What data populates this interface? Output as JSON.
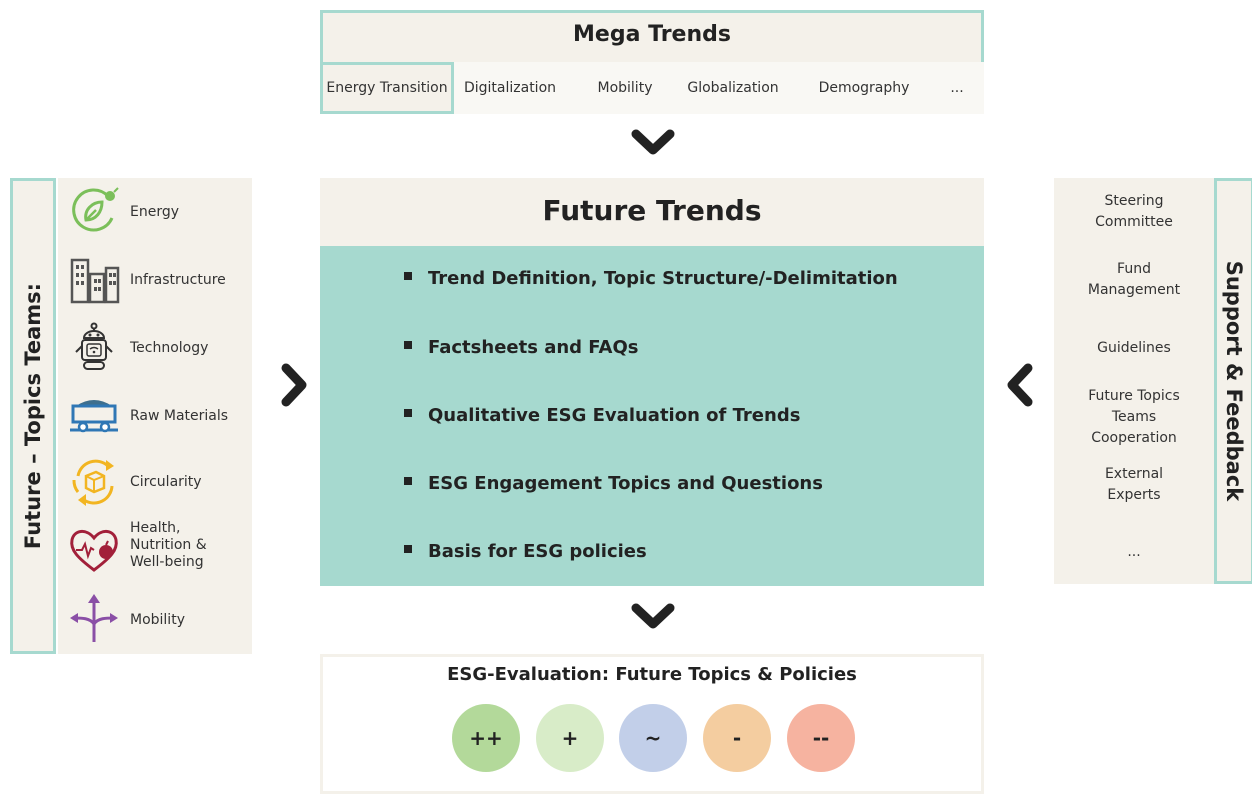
{
  "mega_trends": {
    "title": "Mega Trends",
    "items": [
      "Energy Transition",
      "Digitalization",
      "Mobility",
      "Globalization",
      "Demography",
      "..."
    ]
  },
  "future_trends": {
    "title": "Future Trends",
    "items": [
      "Trend Definition, Topic Structure/-Delimitation",
      "Factsheets and FAQs",
      "Qualitative ESG Evaluation of Trends",
      "ESG Engagement Topics and Questions",
      "Basis for ESG policies"
    ]
  },
  "left_panel": {
    "label": "Future – Topics Teams:",
    "topics": [
      {
        "label": "Energy",
        "icon": "energy-leaf-plug-icon"
      },
      {
        "label": "Infrastructure",
        "icon": "buildings-icon"
      },
      {
        "label": "Technology",
        "icon": "robot-icon"
      },
      {
        "label": "Raw Materials",
        "icon": "mine-cart-icon"
      },
      {
        "label": "Circularity",
        "icon": "recycle-box-icon"
      },
      {
        "label": "Health,\nNutrition &\nWell-being",
        "icon": "heart-food-icon"
      },
      {
        "label": "Mobility",
        "icon": "split-arrows-icon"
      }
    ]
  },
  "right_panel": {
    "label": "Support & Feedback",
    "items": [
      "Steering\nCommittee",
      "Fund\nManagement",
      "Guidelines",
      "Future Topics\nTeams\nCooperation",
      "External\nExperts",
      "..."
    ]
  },
  "esg": {
    "title": "ESG-Evaluation: Future Topics & Policies",
    "ratings": [
      {
        "label": "++",
        "color": "#b3d99a"
      },
      {
        "label": "+",
        "color": "#d8ecc8"
      },
      {
        "label": "~",
        "color": "#c2cfe9"
      },
      {
        "label": "-",
        "color": "#f4cda0"
      },
      {
        "label": "--",
        "color": "#f6b3a0"
      }
    ]
  },
  "colors": {
    "accent_teal": "#a6d9cf",
    "panel_beige": "#f4f1ea"
  }
}
